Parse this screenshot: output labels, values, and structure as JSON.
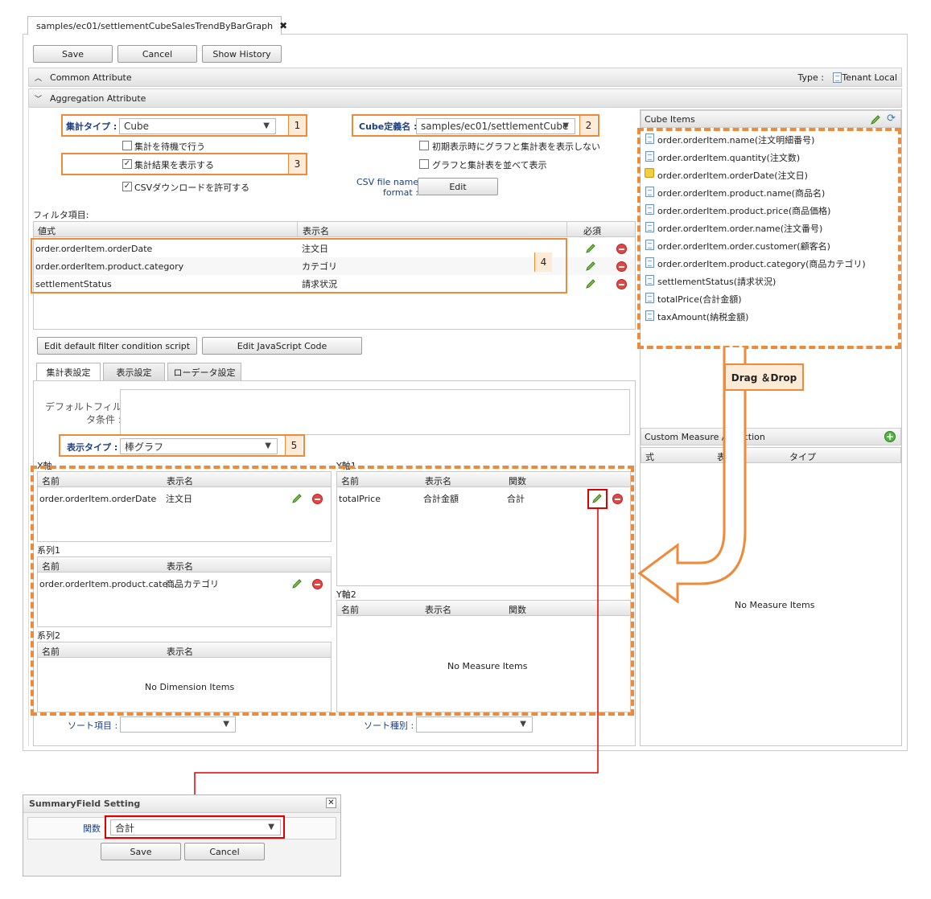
{
  "tab": {
    "title": "samples/ec01/settlementCubeSalesTrendByBarGraph"
  },
  "toolbar": {
    "save": "Save",
    "cancel": "Cancel",
    "history": "Show History"
  },
  "common": {
    "title": "Common Attribute",
    "type_label": "Type :",
    "type_value": "Tenant Local"
  },
  "aggregation": {
    "title": "Aggregation Attribute"
  },
  "form": {
    "agg_type_label": "集計タイプ :",
    "agg_type_value": "Cube",
    "cube_label": "Cube定義名 :",
    "cube_value": "samples/ec01/settlementCube",
    "cb_wait": "集計を待機で行う",
    "cb_show_result": "集計結果を表示する",
    "cb_csv": "CSVダウンロードを許可する",
    "cb_init_hide": "初期表示時にグラフと集計表を表示しない",
    "cb_side": "グラフと集計表を並べて表示",
    "csv_name_label_1": "CSV file name",
    "csv_name_label_2": "format :",
    "csv_edit": "Edit"
  },
  "badges": {
    "b1": "1",
    "b2": "2",
    "b3": "3",
    "b4": "4",
    "b5": "5"
  },
  "filter": {
    "title": "フィルタ項目:",
    "headers": {
      "expr": "値式",
      "display": "表示名",
      "required": "必須"
    },
    "rows": [
      {
        "expr": "order.orderItem.orderDate",
        "display": "注文日"
      },
      {
        "expr": "order.orderItem.product.category",
        "display": "カテゴリ"
      },
      {
        "expr": "settlementStatus",
        "display": "請求状況"
      }
    ]
  },
  "buttons": {
    "edit_filter": "Edit default filter condition script",
    "edit_js": "Edit JavaScript Code"
  },
  "tabs": [
    "集計表設定",
    "表示設定",
    "ローデータ設定"
  ],
  "default_filter_label_1": "デフォルトフィル",
  "default_filter_label_2": "タ条件 :",
  "display_type": {
    "label": "表示タイプ :",
    "value": "棒グラフ"
  },
  "xaxis": {
    "title": "X軸",
    "headers": {
      "name": "名前",
      "display": "表示名"
    },
    "row": {
      "name": "order.orderItem.orderDate",
      "display": "注文日"
    }
  },
  "series1": {
    "title": "系列1",
    "headers": {
      "name": "名前",
      "display": "表示名"
    },
    "row": {
      "name": "order.orderItem.product.cate...",
      "display": "商品カテゴリ"
    }
  },
  "series2": {
    "title": "系列2",
    "headers": {
      "name": "名前",
      "display": "表示名"
    },
    "empty": "No Dimension Items"
  },
  "y1": {
    "title": "Y軸1",
    "headers": {
      "name": "名前",
      "display": "表示名",
      "func": "関数"
    },
    "row": {
      "name": "totalPrice",
      "display": "合計金額",
      "func": "合計"
    }
  },
  "y2": {
    "title": "Y軸2",
    "headers": {
      "name": "名前",
      "display": "表示名",
      "func": "関数"
    },
    "empty": "No Measure Items"
  },
  "sort": {
    "item_label": "ソート項目 :",
    "kind_label": "ソート種別 :"
  },
  "cube_items": {
    "title": "Cube Items",
    "items": [
      "order.orderItem.name(注文明細番号)",
      "order.orderItem.quantity(注文数)",
      "order.orderItem.orderDate(注文日)",
      "order.orderItem.product.name(商品名)",
      "order.orderItem.product.price(商品価格)",
      "order.orderItem.order.name(注文番号)",
      "order.orderItem.order.customer(顧客名)",
      "order.orderItem.product.category(商品カテゴリ)",
      "settlementStatus(請求状況)",
      "totalPrice(合計金額)",
      "taxAmount(納税金額)"
    ]
  },
  "drag_drop": "Drag ＆Drop",
  "custom": {
    "title": "Custom Measure / Function",
    "headers": {
      "expr": "式",
      "display": "表示名",
      "type": "タイプ"
    },
    "empty": "No Measure Items"
  },
  "dialog": {
    "title": "SummaryField Setting",
    "func_label": "関数 :",
    "func_value": "合計",
    "save": "Save",
    "cancel": "Cancel"
  },
  "colors": {
    "accent_orange": "#ed8b3a",
    "highlight_red": "#e00000"
  }
}
